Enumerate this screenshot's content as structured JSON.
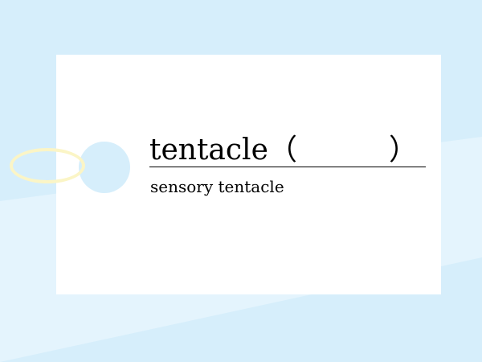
{
  "colors": {
    "background": "#d6eefb",
    "background_band": "#e4f4fd",
    "card": "#ffffff",
    "hole": "#d6eefb",
    "ring": "#fbf5c6"
  },
  "flashcard": {
    "word": "tentacle",
    "open_paren": "（",
    "close_paren": "）",
    "phrase": "sensory tentacle"
  }
}
